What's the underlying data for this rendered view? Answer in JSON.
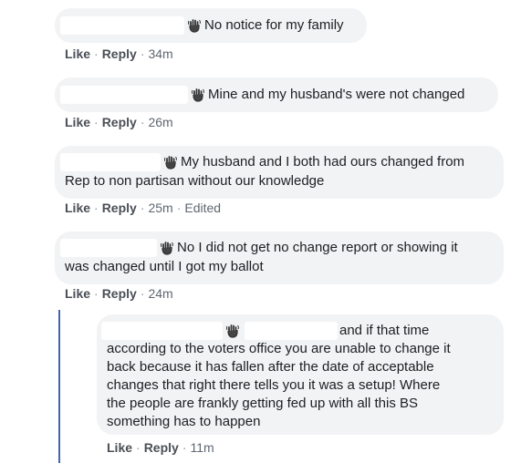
{
  "icons": {
    "reaction": "waving-hand-icon"
  },
  "separator": "·",
  "comments": [
    {
      "text": "No notice for my family",
      "like_label": "Like",
      "reply_label": "Reply",
      "time": "34m",
      "edited": ""
    },
    {
      "text": "Mine and my husband's were not changed",
      "like_label": "Like",
      "reply_label": "Reply",
      "time": "26m",
      "edited": ""
    },
    {
      "text_line1": "My husband and I both had ours changed from",
      "text_line2": "Rep to non partisan without our knowledge",
      "like_label": "Like",
      "reply_label": "Reply",
      "time": "25m",
      "edited": "Edited"
    },
    {
      "text_line1": "No I did not get no change report or showing it",
      "text_line2": "was changed until I got my ballot",
      "like_label": "Like",
      "reply_label": "Reply",
      "time": "24m",
      "edited": ""
    }
  ],
  "reply": {
    "text_first": "and if that time",
    "lines": [
      "according to the voters office you are unable to change it",
      "back because it has fallen after the date of acceptable",
      "changes that right there tells you it was a setup! Where",
      "the people are frankly getting fed up with all this BS",
      "something has to happen"
    ],
    "like_label": "Like",
    "reply_label": "Reply",
    "time": "11m"
  }
}
